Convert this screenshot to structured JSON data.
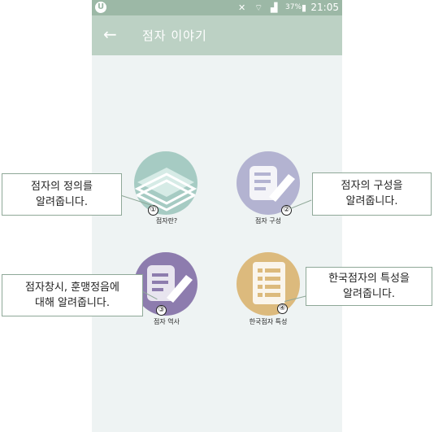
{
  "status_bar": {
    "logo": "U",
    "battery": "37%",
    "time": "21:05",
    "icons": [
      "mute-icon",
      "wifi-icon",
      "signal-icon",
      "battery-icon"
    ]
  },
  "app_bar": {
    "back_icon": "back-arrow-icon",
    "title": "점자 이야기"
  },
  "menu": [
    {
      "label": "점자란?",
      "number": "①",
      "icon": "book-stack-icon",
      "color": "#a6cbc3"
    },
    {
      "label": "점자 구성",
      "number": "②",
      "icon": "edit-document-icon",
      "color": "#b3b3d1"
    },
    {
      "label": "점자 역사",
      "number": "③",
      "icon": "history-document-icon",
      "color": "#8d7cae"
    },
    {
      "label": "한국점자 특성",
      "number": "④",
      "icon": "list-document-icon",
      "color": "#dcba7d"
    }
  ],
  "callouts": [
    "점자의 정의를\n알려줍니다.",
    "점자의 구성을\n알려줍니다.",
    "점자창시, 훈맹정음에\n대해 알려줍니다.",
    "한국점자의 특성을\n알려줍니다."
  ]
}
